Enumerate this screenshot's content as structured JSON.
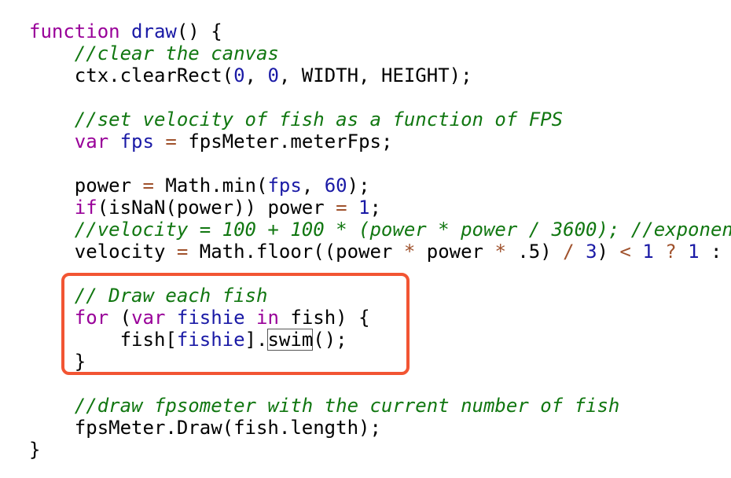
{
  "code": {
    "lines": [
      [
        {
          "t": "function ",
          "c": "kw"
        },
        {
          "t": "draw",
          "c": "fn"
        },
        {
          "t": "() {",
          "c": "plain"
        }
      ],
      [
        {
          "t": "    //clear the canvas",
          "c": "cm"
        }
      ],
      [
        {
          "t": "    ctx.clearRect(",
          "c": "plain"
        },
        {
          "t": "0",
          "c": "num"
        },
        {
          "t": ", ",
          "c": "plain"
        },
        {
          "t": "0",
          "c": "num"
        },
        {
          "t": ", WIDTH, HEIGHT);",
          "c": "plain"
        }
      ],
      [
        {
          "t": "",
          "c": "plain"
        }
      ],
      [
        {
          "t": "    //set velocity of fish as a function of FPS",
          "c": "cm"
        }
      ],
      [
        {
          "t": "    ",
          "c": "plain"
        },
        {
          "t": "var",
          "c": "kw"
        },
        {
          "t": " ",
          "c": "plain"
        },
        {
          "t": "fps",
          "c": "var"
        },
        {
          "t": " ",
          "c": "plain"
        },
        {
          "t": "=",
          "c": "op"
        },
        {
          "t": " fpsMeter.meterFps;",
          "c": "plain"
        }
      ],
      [
        {
          "t": "",
          "c": "plain"
        }
      ],
      [
        {
          "t": "    power ",
          "c": "plain"
        },
        {
          "t": "=",
          "c": "op"
        },
        {
          "t": " Math.min(",
          "c": "plain"
        },
        {
          "t": "fps",
          "c": "var"
        },
        {
          "t": ", ",
          "c": "plain"
        },
        {
          "t": "60",
          "c": "num"
        },
        {
          "t": ");",
          "c": "plain"
        }
      ],
      [
        {
          "t": "    ",
          "c": "plain"
        },
        {
          "t": "if",
          "c": "kw"
        },
        {
          "t": "(isNaN(power)) power ",
          "c": "plain"
        },
        {
          "t": "=",
          "c": "op"
        },
        {
          "t": " ",
          "c": "plain"
        },
        {
          "t": "1",
          "c": "num"
        },
        {
          "t": ";",
          "c": "plain"
        }
      ],
      [
        {
          "t": "    //velocity = 100 + 100 * (power * power / 3600); //exponen",
          "c": "cm"
        }
      ],
      [
        {
          "t": "    velocity ",
          "c": "plain"
        },
        {
          "t": "=",
          "c": "op"
        },
        {
          "t": " Math.floor((power ",
          "c": "plain"
        },
        {
          "t": "*",
          "c": "op"
        },
        {
          "t": " power ",
          "c": "plain"
        },
        {
          "t": "*",
          "c": "op"
        },
        {
          "t": " .5) ",
          "c": "plain"
        },
        {
          "t": "/",
          "c": "op"
        },
        {
          "t": " ",
          "c": "plain"
        },
        {
          "t": "3",
          "c": "num"
        },
        {
          "t": ") ",
          "c": "plain"
        },
        {
          "t": "<",
          "c": "op"
        },
        {
          "t": " ",
          "c": "plain"
        },
        {
          "t": "1",
          "c": "num"
        },
        {
          "t": " ",
          "c": "plain"
        },
        {
          "t": "?",
          "c": "op"
        },
        {
          "t": " ",
          "c": "plain"
        },
        {
          "t": "1",
          "c": "num"
        },
        {
          "t": " :",
          "c": "plain"
        }
      ],
      [
        {
          "t": "",
          "c": "plain"
        }
      ],
      [
        {
          "t": "    // Draw each fish",
          "c": "cm"
        }
      ],
      [
        {
          "t": "    ",
          "c": "plain"
        },
        {
          "t": "for",
          "c": "kw"
        },
        {
          "t": " (",
          "c": "plain"
        },
        {
          "t": "var",
          "c": "kw"
        },
        {
          "t": " ",
          "c": "plain"
        },
        {
          "t": "fishie",
          "c": "var"
        },
        {
          "t": " ",
          "c": "plain"
        },
        {
          "t": "in",
          "c": "kw"
        },
        {
          "t": " fish) {",
          "c": "plain"
        }
      ],
      [
        {
          "t": "        fish[",
          "c": "plain"
        },
        {
          "t": "fishie",
          "c": "var"
        },
        {
          "t": "].",
          "c": "plain"
        },
        {
          "t": "swim",
          "c": "boxed"
        },
        {
          "t": "();",
          "c": "plain"
        }
      ],
      [
        {
          "t": "    }",
          "c": "plain"
        }
      ],
      [
        {
          "t": "",
          "c": "plain"
        }
      ],
      [
        {
          "t": "    //draw fpsometer with the current number of fish",
          "c": "cm"
        }
      ],
      [
        {
          "t": "    fpsMeter.Draw(fish.length);",
          "c": "plain"
        }
      ],
      [
        {
          "t": "}",
          "c": "plain"
        }
      ]
    ]
  },
  "annotation": {
    "color": "#f25533"
  }
}
